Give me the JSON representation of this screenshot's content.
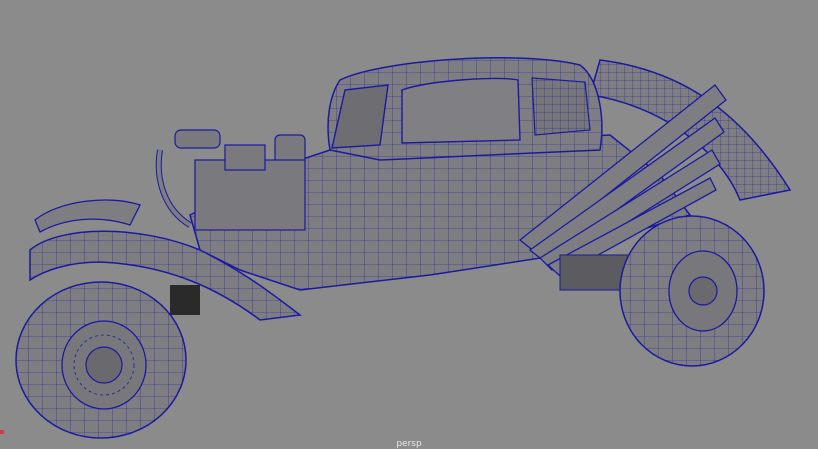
{
  "viewport": {
    "camera_label": "persp",
    "background_color": "#8b8b8b",
    "model_fill_color": "#7e7e82",
    "wireframe_color": "#1a1aa0",
    "axis_marker_color": "#d23b3b"
  }
}
